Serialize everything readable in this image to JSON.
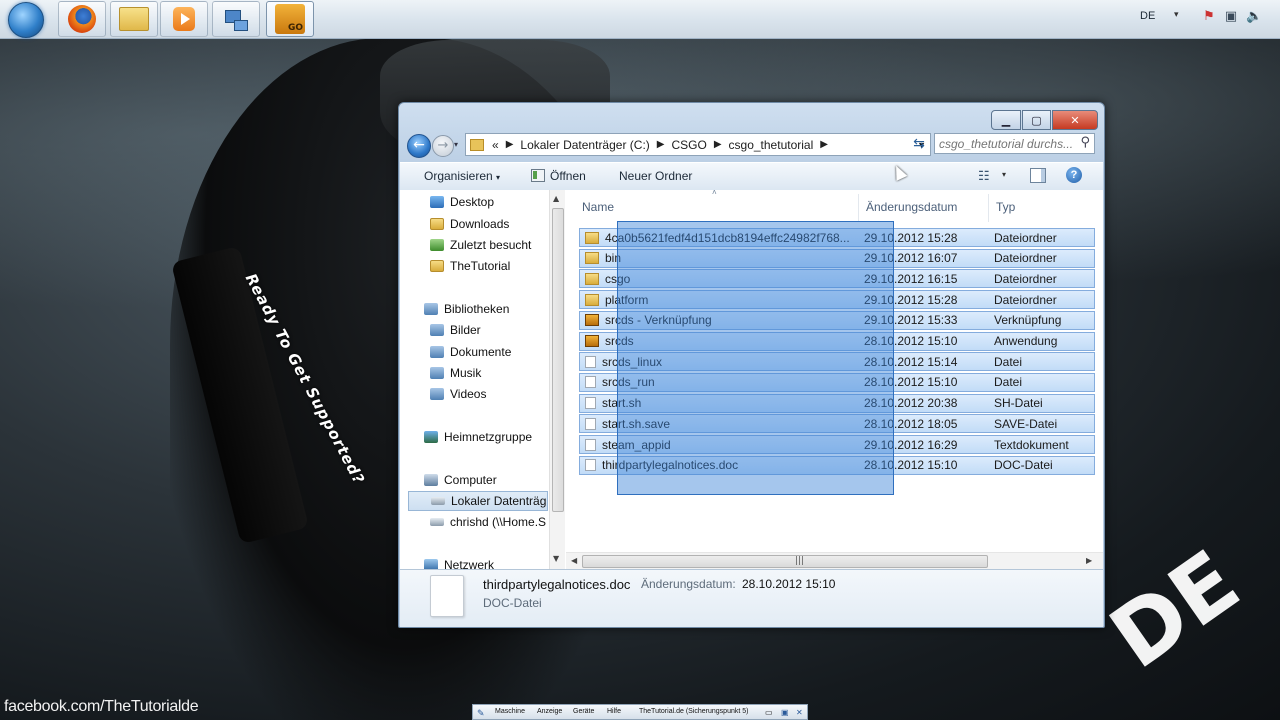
{
  "desktop": {
    "slogan": "Ready To Get Supported?",
    "brand_text": "DE",
    "facebook_text": "facebook.com/TheTutorialde"
  },
  "taskbar": {
    "apps": [
      {
        "name": "firefox-icon"
      },
      {
        "name": "windows-explorer-icon"
      },
      {
        "name": "media-player-icon"
      },
      {
        "name": "network-icon"
      },
      {
        "name": "csgo-icon",
        "label": "GO"
      }
    ],
    "language": "DE"
  },
  "window": {
    "address": {
      "prefix": "«",
      "crumbs": [
        "Lokaler Datenträger (C:)",
        "CSGO",
        "csgo_thetutorial"
      ]
    },
    "search_placeholder": "csgo_thetutorial durchs...",
    "toolbar": {
      "organize": "Organisieren",
      "open": "Öffnen",
      "new_folder": "Neuer Ordner"
    },
    "nav": {
      "favorites": [
        "Desktop",
        "Downloads",
        "Zuletzt besucht",
        "TheTutorial"
      ],
      "libraries": "Bibliotheken",
      "library_items": [
        "Bilder",
        "Dokumente",
        "Musik",
        "Videos"
      ],
      "homegroup": "Heimnetzgruppe",
      "computer": "Computer",
      "computer_items": [
        "Lokaler Datenträg",
        "chrishd (\\\\Home.S"
      ],
      "network": "Netzwerk"
    },
    "columns": {
      "name": "Name",
      "date": "Änderungsdatum",
      "type": "Typ"
    },
    "files": [
      {
        "name": "4ca0b5621fedf4d151dcb8194effc24982f768...",
        "date": "29.10.2012 15:28",
        "type": "Dateiordner",
        "icon": "folder"
      },
      {
        "name": "bin",
        "date": "29.10.2012 16:07",
        "type": "Dateiordner",
        "icon": "folder"
      },
      {
        "name": "csgo",
        "date": "29.10.2012 16:15",
        "type": "Dateiordner",
        "icon": "folder"
      },
      {
        "name": "platform",
        "date": "29.10.2012 15:28",
        "type": "Dateiordner",
        "icon": "folder"
      },
      {
        "name": "srcds - Verknüpfung",
        "date": "29.10.2012 15:33",
        "type": "Verknüpfung",
        "icon": "app"
      },
      {
        "name": "srcds",
        "date": "28.10.2012 15:10",
        "type": "Anwendung",
        "icon": "app"
      },
      {
        "name": "srcds_linux",
        "date": "28.10.2012 15:14",
        "type": "Datei",
        "icon": "file"
      },
      {
        "name": "srcds_run",
        "date": "28.10.2012 15:10",
        "type": "Datei",
        "icon": "file"
      },
      {
        "name": "start.sh",
        "date": "28.10.2012 20:38",
        "type": "SH-Datei",
        "icon": "file"
      },
      {
        "name": "start.sh.save",
        "date": "28.10.2012 18:05",
        "type": "SAVE-Datei",
        "icon": "file"
      },
      {
        "name": "steam_appid",
        "date": "29.10.2012 16:29",
        "type": "Textdokument",
        "icon": "file"
      },
      {
        "name": "thirdpartylegalnotices.doc",
        "date": "28.10.2012 15:10",
        "type": "DOC-Datei",
        "icon": "file"
      }
    ],
    "details": {
      "name": "thirdpartylegalnotices.doc",
      "date_label": "Änderungsdatum:",
      "date_value": "28.10.2012 15:10",
      "type": "DOC-Datei"
    }
  },
  "vbox_bar": {
    "items": [
      "Maschine",
      "Anzeige",
      "Geräte",
      "Hilfe"
    ],
    "title": "TheTutorial.de (Sicherungspunkt 5)"
  }
}
